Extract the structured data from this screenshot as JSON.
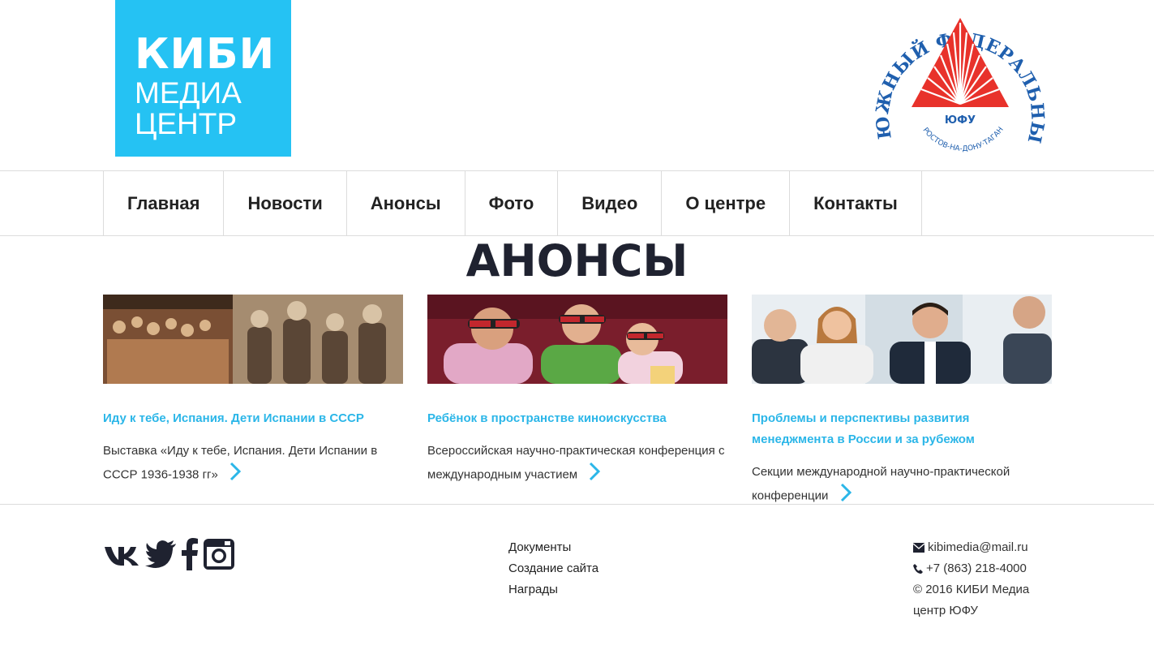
{
  "header": {
    "logo": {
      "line1": "КИБИ",
      "line2": "МЕДИА",
      "line3": "ЦЕНТР",
      "bg_color": "#25c2f3"
    },
    "university_seal": {
      "text": "ЮЖНЫЙ ФЕДЕРАЛЬНЫЙ УНИВЕРСИТЕТ",
      "city_text": "РОСТОВ-НА-ДОНУ·ТАГАНРОГ",
      "abbr": "ЮФУ"
    }
  },
  "nav": {
    "items": [
      "Главная",
      "Новости",
      "Анонсы",
      "Фото",
      "Видео",
      "О центре",
      "Контакты"
    ]
  },
  "page_title": "АНОНСЫ",
  "cards": [
    {
      "image_icon": "spanish-children-photo",
      "title": "Иду к тебе, Испания. Дети Испании в СССР",
      "description": "Выставка «Иду к тебе, Испания. Дети Испании в СССР 1936-1938 гг»"
    },
    {
      "image_icon": "children-3d-cinema-photo",
      "title": "Ребёнок в пространстве киноискусства",
      "description": "Всероссийская научно-практическая конференция с международным участием"
    },
    {
      "image_icon": "business-meeting-photo",
      "title": "Проблемы и перспективы развития менеджмента в России и за рубежом",
      "description": "Секции международной научно-практической конференции"
    }
  ],
  "footer": {
    "social_icons": [
      "vk-icon",
      "twitter-icon",
      "facebook-icon",
      "instagram-icon"
    ],
    "links": [
      "Документы",
      "Создание сайта",
      "Награды"
    ],
    "contacts": {
      "email": "kibimedia@mail.ru",
      "phone": "+7 (863) 218-4000",
      "copyright": "© 2016 КИБИ Медиа центр ЮФУ"
    }
  },
  "colors": {
    "accent": "#2bb6e8",
    "title": "#1f2230",
    "seal_blue": "#1f5fae",
    "seal_red": "#e8322b"
  }
}
